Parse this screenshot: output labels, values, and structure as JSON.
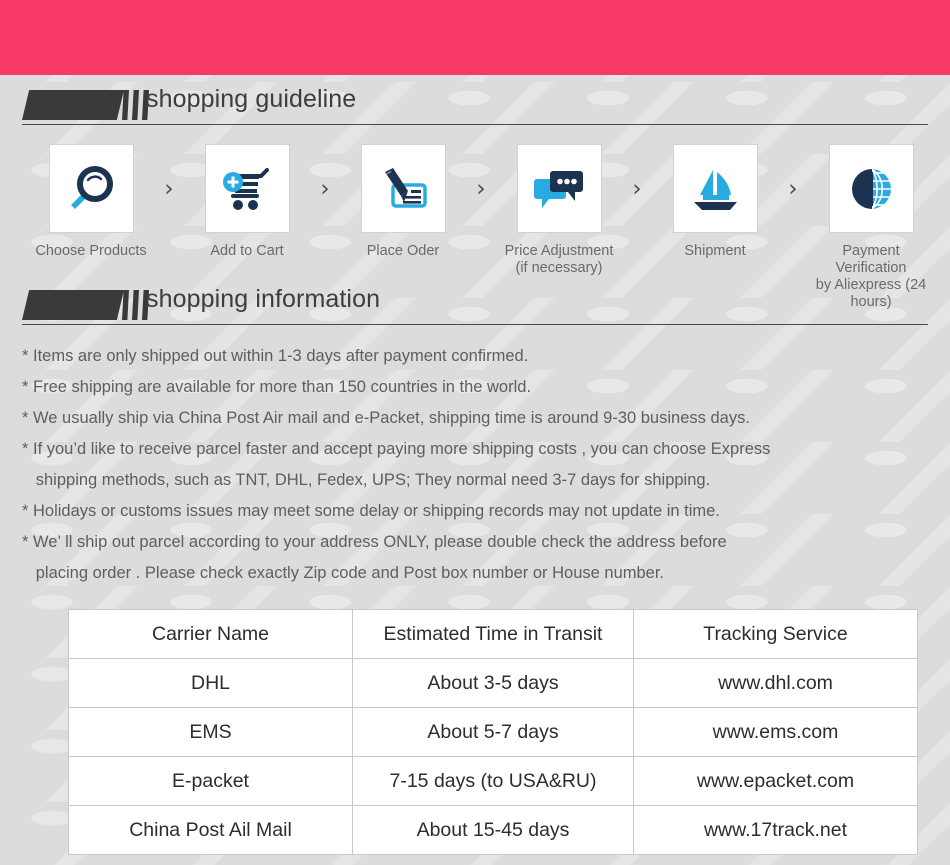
{
  "theme": {
    "banner_color": "#f73a65",
    "page_background": "#dcdcdc",
    "badge_color": "#3a3a3a",
    "icon_dark": "#1b3350",
    "icon_light": "#29abe2",
    "text_color": "#5e5e5e"
  },
  "sections": {
    "guideline": {
      "title": "shopping guideline"
    },
    "information": {
      "title": "shopping information"
    }
  },
  "steps": [
    {
      "icon": "magnifier-icon",
      "label": "Choose Products"
    },
    {
      "icon": "add-to-cart-icon",
      "label": "Add to Cart"
    },
    {
      "icon": "pen-check-icon",
      "label": "Place Oder"
    },
    {
      "icon": "chat-bubbles-icon",
      "label": "Price Adjustment\n(if necessary)"
    },
    {
      "icon": "sailboat-icon",
      "label": "Shipment"
    },
    {
      "icon": "dollar-globe-icon",
      "label": "Payment Verification\nby  Aliexpress (24 hours)"
    }
  ],
  "step_separator": "›",
  "info_lines": [
    "* Items are only shipped out within 1-3 days after payment confirmed.",
    "* Free shipping are available for more than 150 countries in the world.",
    "* We usually ship via China Post Air mail and e-Packet, shipping time is around 9-30 business days.",
    "* If you’d like to receive parcel faster and accept paying more shipping costs , you can choose Express",
    "   shipping methods, such as TNT, DHL, Fedex, UPS; They normal need 3-7 days for shipping.",
    "* Holidays or customs issues may meet some delay or shipping records may not update in time.",
    "* We’ ll ship out parcel according to your address ONLY, please double check the address before",
    "   placing order . Please check exactly Zip code and Post box number or House number."
  ],
  "carrier_table": {
    "headers": [
      "Carrier Name",
      "Estimated Time in Transit",
      "Tracking Service"
    ],
    "rows": [
      [
        "DHL",
        "About 3-5 days",
        "www.dhl.com"
      ],
      [
        "EMS",
        "About 5-7 days",
        "www.ems.com"
      ],
      [
        "E-packet",
        "7-15 days (to USA&RU)",
        "www.epacket.com"
      ],
      [
        "China Post Ail Mail",
        "About 15-45 days",
        "www.17track.net"
      ]
    ]
  }
}
